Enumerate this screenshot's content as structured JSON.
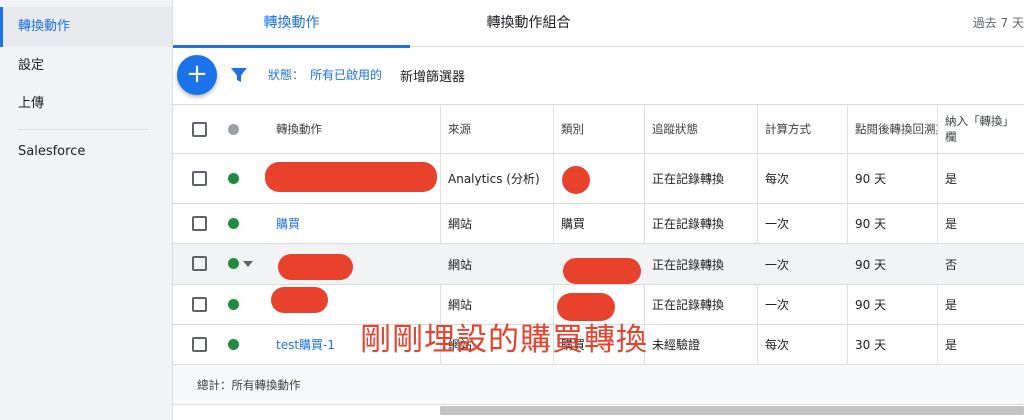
{
  "sidebar": {
    "items": [
      {
        "label": "轉換動作"
      },
      {
        "label": "設定"
      },
      {
        "label": "上傳"
      },
      {
        "label": "Salesforce"
      }
    ]
  },
  "tabs": [
    {
      "label": "轉換動作"
    },
    {
      "label": "轉換動作組合"
    }
  ],
  "date_range": "過去 7 天",
  "toolbar": {
    "add_icon": "+",
    "status_label": "狀態：",
    "status_value": "所有已啟用的",
    "add_filter": "新增篩選器"
  },
  "table": {
    "headers": {
      "name": "轉換動作",
      "source": "來源",
      "category": "類別",
      "tracking": "追蹤狀態",
      "counting": "計算方式",
      "window": "點閱後轉換回溯期",
      "include": "納入「轉換」欄"
    },
    "rows": [
      {
        "name": "",
        "source": "Analytics (分析)",
        "category": "",
        "tracking": "正在記錄轉換",
        "counting": "每次",
        "window": "90 天",
        "include": "是"
      },
      {
        "name": "購買",
        "source": "網站",
        "category": "購買",
        "tracking": "正在記錄轉換",
        "counting": "一次",
        "window": "90 天",
        "include": "是"
      },
      {
        "name": "",
        "source": "網站",
        "category": "",
        "tracking": "正在記錄轉換",
        "counting": "一次",
        "window": "90 天",
        "include": "否"
      },
      {
        "name": "",
        "source": "網站",
        "category": "",
        "tracking": "正在記錄轉換",
        "counting": "一次",
        "window": "90 天",
        "include": "是"
      },
      {
        "name": "test購買-1",
        "source": "網站",
        "category": "購買",
        "tracking": "未經驗證",
        "counting": "每次",
        "window": "30 天",
        "include": "是"
      }
    ],
    "total_label": "總計：所有轉換動作"
  },
  "annotation": "剛剛埋設的購買轉換",
  "colors": {
    "accent": "#1a73e8",
    "status_active": "#1e8e3e",
    "annotation_red": "#e8412c"
  }
}
